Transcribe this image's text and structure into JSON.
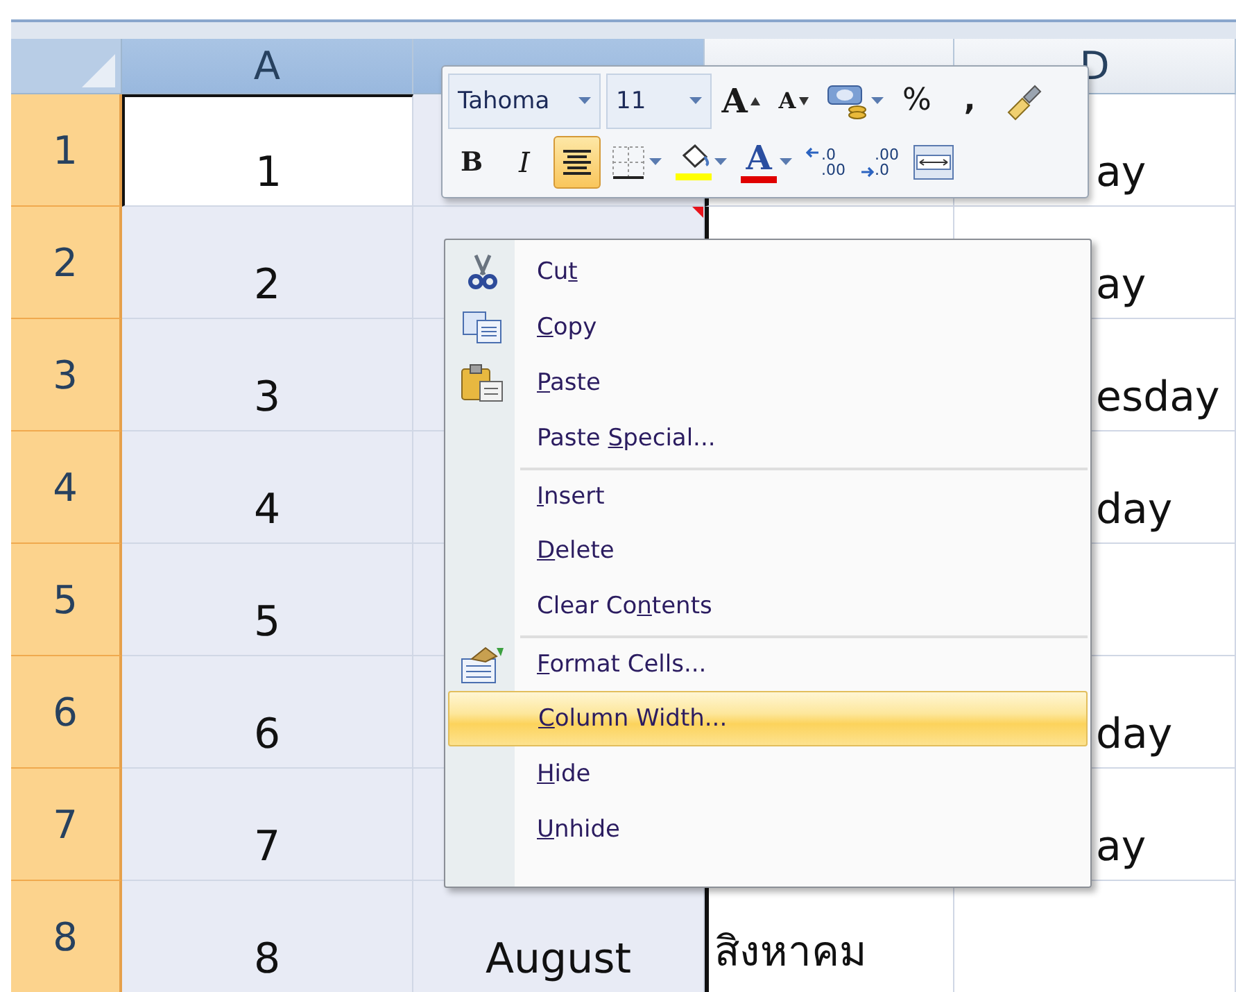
{
  "columns": [
    {
      "label": "A",
      "selected": true
    },
    {
      "selected": true
    },
    {
      "selected": false
    },
    {
      "label": "D",
      "selected": false
    }
  ],
  "rows": [
    {
      "header": "1",
      "selected": true,
      "cells": [
        {
          "text": "1",
          "active": true
        },
        {},
        {},
        {
          "text": "ay"
        }
      ]
    },
    {
      "header": "2",
      "selected": true,
      "cells": [
        {
          "text": "2"
        },
        {
          "comment": true
        },
        {},
        {
          "text": "ay"
        }
      ]
    },
    {
      "header": "3",
      "selected": true,
      "cells": [
        {
          "text": "3"
        },
        {},
        {},
        {
          "text": "esday"
        }
      ]
    },
    {
      "header": "4",
      "selected": true,
      "cells": [
        {
          "text": "4"
        },
        {},
        {},
        {
          "text": "day"
        }
      ]
    },
    {
      "header": "5",
      "selected": true,
      "cells": [
        {
          "text": "5"
        },
        {},
        {},
        {}
      ]
    },
    {
      "header": "6",
      "selected": true,
      "cells": [
        {
          "text": "6"
        },
        {},
        {},
        {
          "text": "day"
        }
      ]
    },
    {
      "header": "7",
      "selected": true,
      "cells": [
        {
          "text": "7"
        },
        {},
        {},
        {
          "text": "ay"
        }
      ]
    },
    {
      "header": "8",
      "selected": true,
      "cells": [
        {
          "text": "8"
        },
        {
          "text": "August"
        },
        {
          "text": "สิงหาคม"
        },
        {}
      ]
    }
  ],
  "mini_toolbar": {
    "font_group": [
      {
        "kind": "combo",
        "value": "Tahoma"
      },
      {
        "kind": "combo",
        "value": "11"
      },
      {
        "kind": "grow-font",
        "label": "A",
        "selected": false
      },
      {
        "kind": "shrink-font",
        "label": "A",
        "selected": false
      },
      {
        "kind": "accounting",
        "selected": false
      },
      {
        "kind": "char",
        "label": "%",
        "selected": false
      },
      {
        "kind": "char",
        "label": ",",
        "selected": false
      },
      {
        "kind": "painter",
        "selected": false
      }
    ],
    "format_group": [
      {
        "kind": "bold",
        "label": "B",
        "selected": false
      },
      {
        "kind": "italic",
        "label": "I",
        "selected": false
      },
      {
        "kind": "center",
        "selected": true
      },
      {
        "kind": "borders",
        "selected": false
      },
      {
        "kind": "fill",
        "selected": false
      },
      {
        "kind": "font-color",
        "label": "A",
        "selected": false
      },
      {
        "kind": "inc-decimal",
        "label": ".0",
        "label2": ".00",
        "selected": false
      },
      {
        "kind": "dec-decimal",
        "label": ".00",
        "label2": ".0",
        "selected": false
      },
      {
        "kind": "merge",
        "selected": false
      }
    ]
  },
  "context_menu": {
    "items": [
      {
        "kind": "cut",
        "label": {
          "pre": "Cu",
          "key": "t"
        },
        "selected": false,
        "separator_before": false
      },
      {
        "kind": "copy",
        "label": {
          "key": "C",
          "post": "opy"
        },
        "selected": false,
        "separator_before": false
      },
      {
        "kind": "paste",
        "label": {
          "key": "P",
          "post": "aste"
        },
        "selected": false,
        "separator_before": false
      },
      {
        "kind": "plain",
        "label": {
          "pre": "Paste ",
          "key": "S",
          "post": "pecial..."
        },
        "selected": false,
        "separator_before": false
      },
      {
        "kind": "plain",
        "label": {
          "key": "I",
          "post": "nsert"
        },
        "selected": false,
        "separator_before": true
      },
      {
        "kind": "plain",
        "label": {
          "key": "D",
          "post": "elete"
        },
        "selected": false,
        "separator_before": false
      },
      {
        "kind": "plain",
        "label": {
          "pre": "Clear Co",
          "key": "n",
          "post": "tents"
        },
        "selected": false,
        "separator_before": false
      },
      {
        "kind": "format",
        "label": {
          "key": "F",
          "post": "ormat Cells..."
        },
        "selected": false,
        "separator_before": true
      },
      {
        "kind": "plain",
        "label": {
          "key": "C",
          "post": "olumn Width..."
        },
        "selected": true,
        "separator_before": false
      },
      {
        "kind": "plain",
        "label": {
          "key": "H",
          "post": "ide"
        },
        "selected": false,
        "separator_before": false
      },
      {
        "kind": "plain",
        "label": {
          "key": "U",
          "post": "nhide"
        },
        "selected": false,
        "separator_before": false
      }
    ]
  }
}
